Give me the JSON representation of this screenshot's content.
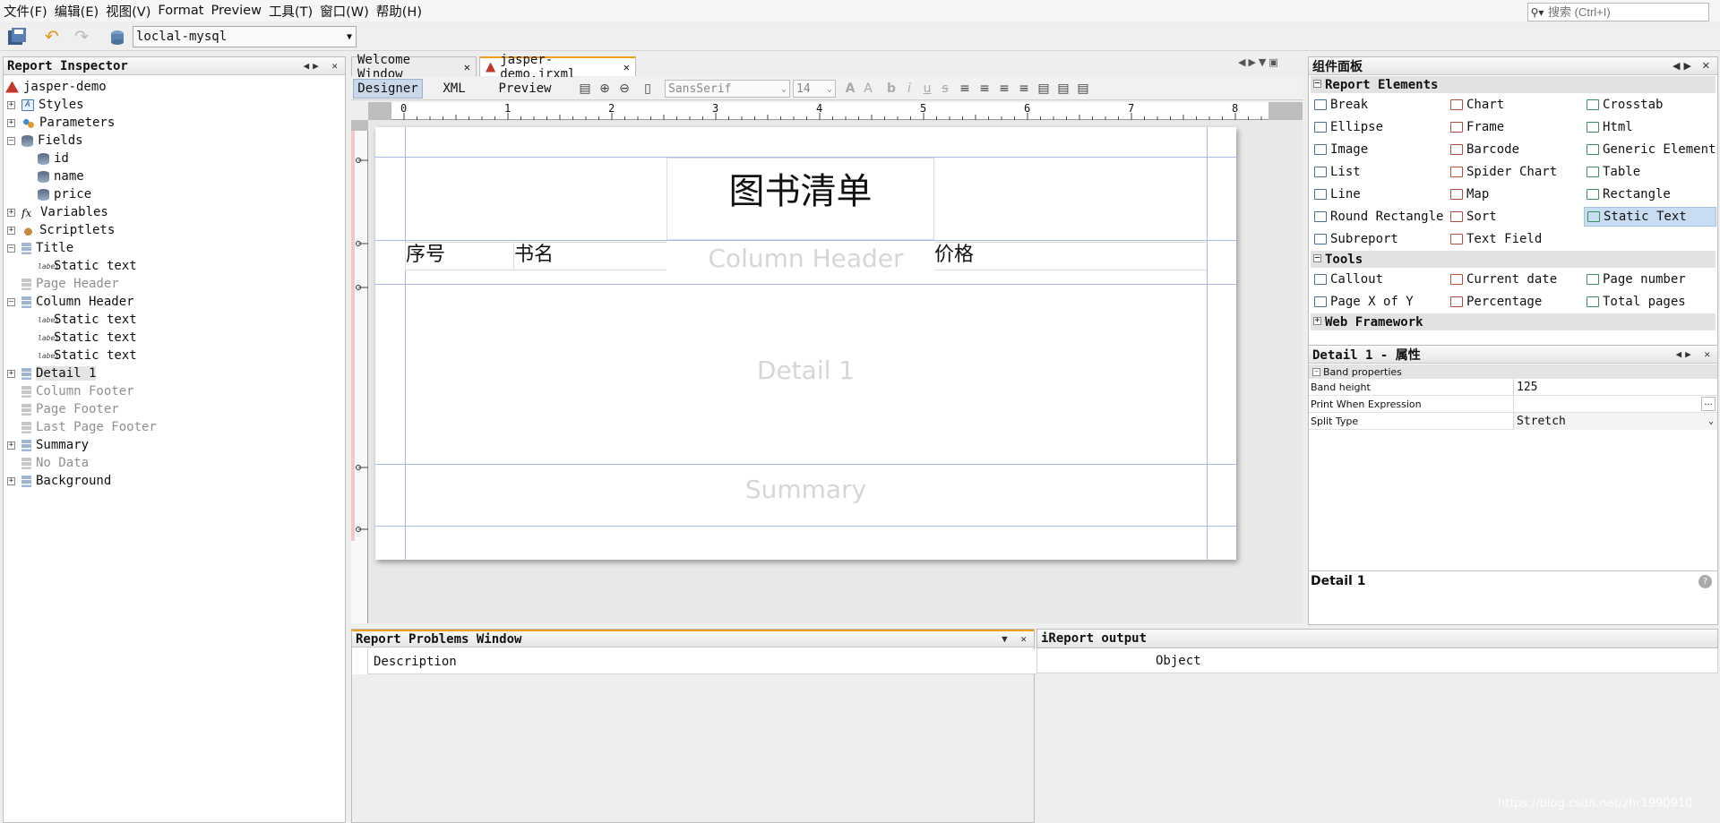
{
  "menubar": {
    "items": [
      "文件(F)",
      "编辑(E)",
      "视图(V)",
      "Format",
      "Preview",
      "工具(T)",
      "窗口(W)",
      "帮助(H)"
    ],
    "search_placeholder": "搜索 (Ctrl+I)"
  },
  "toolbar": {
    "datasource": "loclal-mysql"
  },
  "inspector": {
    "title": "Report Inspector",
    "nodes": {
      "root": "jasper-demo",
      "styles": "Styles",
      "parameters": "Parameters",
      "fields": "Fields",
      "field_id": "id",
      "field_name": "name",
      "field_price": "price",
      "variables": "Variables",
      "scriptlets": "Scriptlets",
      "title": "Title",
      "title_static": "Static text",
      "page_header": "Page Header",
      "column_header": "Column Header",
      "ch_static1": "Static text",
      "ch_static2": "Static text",
      "ch_static3": "Static text",
      "detail1": "Detail 1",
      "column_footer": "Column Footer",
      "page_footer": "Page Footer",
      "last_page_footer": "Last Page Footer",
      "summary": "Summary",
      "no_data": "No Data",
      "background": "Background"
    }
  },
  "editor": {
    "tabs": [
      "Welcome Window",
      "jasper-demo.jrxml"
    ],
    "views": [
      "Designer",
      "XML",
      "Preview"
    ],
    "font_family": "SansSerif",
    "font_size": "14",
    "ruler_labels": [
      "0",
      "1",
      "2",
      "3",
      "4",
      "5",
      "6",
      "7",
      "8"
    ],
    "report": {
      "title_text": "图书清单",
      "col_headers": [
        "序号",
        "书名",
        "价格"
      ],
      "band_column_header": "Column Header",
      "band_detail": "Detail 1",
      "band_summary": "Summary"
    }
  },
  "palette": {
    "title": "组件面板",
    "sections": {
      "report_elements": "Report Elements",
      "tools": "Tools",
      "web_framework": "Web Framework"
    },
    "report_elements": [
      [
        "Break",
        "Chart",
        "Crosstab"
      ],
      [
        "Ellipse",
        "Frame",
        "Html"
      ],
      [
        "Image",
        "Barcode",
        "Generic Element"
      ],
      [
        "List",
        "Spider Chart",
        "Table"
      ],
      [
        "Line",
        "Map",
        "Rectangle"
      ],
      [
        "Round Rectangle",
        "Sort",
        "Static Text"
      ],
      [
        "Subreport",
        "Text Field",
        ""
      ]
    ],
    "tools": [
      [
        "Callout",
        "Current date",
        "Page number"
      ],
      [
        "Page X of Y",
        "Percentage",
        "Total pages"
      ]
    ]
  },
  "properties": {
    "title": "Detail 1 - 属性",
    "group": "Band properties",
    "rows": [
      {
        "key": "Band height",
        "value": "125"
      },
      {
        "key": "Print When Expression",
        "value": ""
      },
      {
        "key": "Split Type",
        "value": "Stretch"
      }
    ],
    "footer_title": "Detail 1"
  },
  "problems": {
    "title": "Report Problems Window",
    "col_description": "Description",
    "col_object": "Object"
  },
  "output": {
    "title": "iReport output"
  },
  "watermark": "https://blog.csdn.net/zhr1990910"
}
